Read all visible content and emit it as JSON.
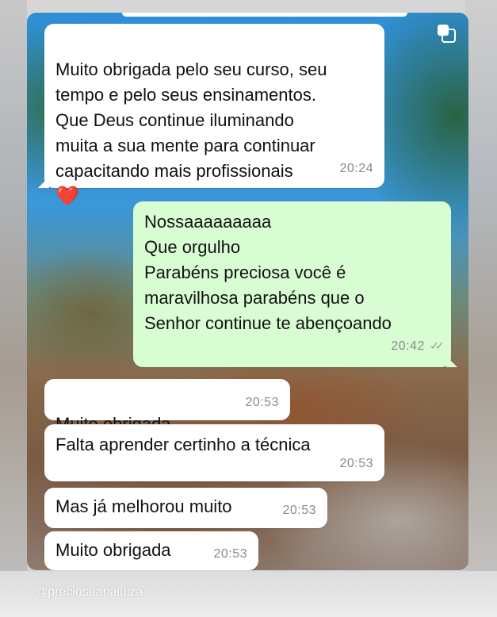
{
  "messages": [
    {
      "direction": "incoming",
      "text": "Muito obrigada pelo seu curso, seu\ntempo e pelo seus ensinamentos.\nQue Deus continue  iluminando\nmuita a sua mente para continuar\ncapacitando mais profissionais",
      "emoji": "❤️",
      "time": "20:24"
    },
    {
      "direction": "outgoing",
      "text": "Nossaaaaaaaaa\nQue orgulho\nParabéns preciosa você é\nmaravilhosa parabéns que o\nSenhor continue te abençoando",
      "time": "20:42",
      "read_receipt": "✓✓"
    },
    {
      "direction": "incoming",
      "text": "Muito obrigada",
      "emoji": "❤️",
      "time": "20:53"
    },
    {
      "direction": "incoming",
      "text": "Falta aprender certinho a técnica",
      "time": "20:53"
    },
    {
      "direction": "incoming",
      "text": "Mas já melhorou muito",
      "time": "20:53"
    },
    {
      "direction": "incoming",
      "text": "Muito obrigada",
      "time": "20:53"
    }
  ],
  "watermark": "@preciosaanaluiza",
  "icons": {
    "corner": "copy-icon",
    "tick": "double-check-icon"
  },
  "colors": {
    "incoming_bubble": "#ffffff",
    "outgoing_bubble": "#d9fdd3",
    "heart": "#e0151b"
  }
}
